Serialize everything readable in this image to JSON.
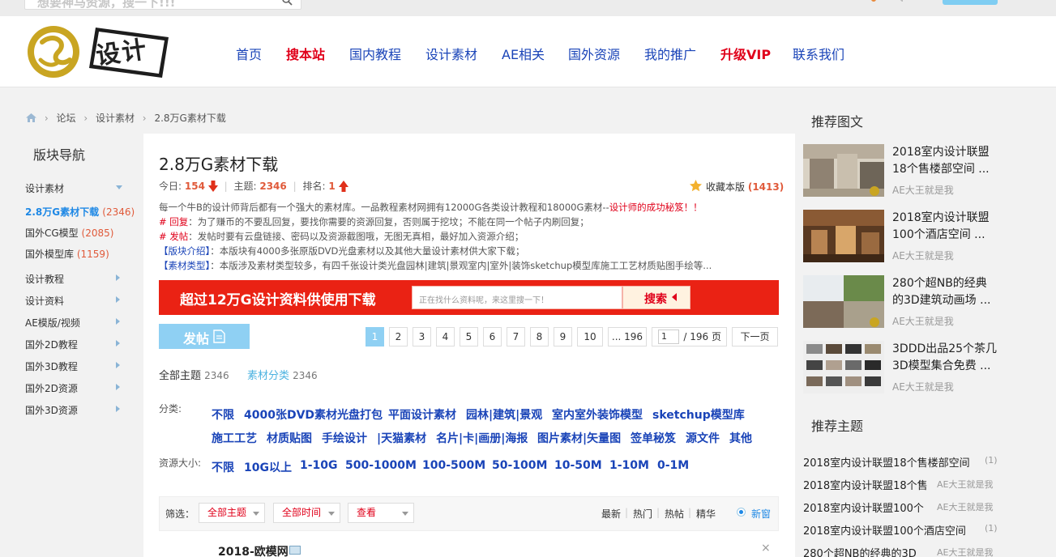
{
  "top_search": {
    "placeholder": "想要神马资源，搜一下!!!"
  },
  "logo": {
    "text": "设计"
  },
  "nav": [
    "首页",
    "搜本站",
    "国内教程",
    "设计素材",
    "AE相关",
    "国外资源",
    "我的推广",
    "升级VIP",
    "联系我们"
  ],
  "breadcrumb": [
    "论坛",
    "设计素材",
    "2.8万G素材下载"
  ],
  "sidebar": {
    "title": "版块导航",
    "items": [
      {
        "label": "设计素材",
        "count": ""
      },
      {
        "label": "2.8万G素材下载",
        "count": "(2346)"
      },
      {
        "label": "国外CG模型",
        "count": "(2085)"
      },
      {
        "label": "国外模型库",
        "count": "(1159)"
      },
      {
        "label": "设计教程",
        "count": ""
      },
      {
        "label": "设计资料",
        "count": ""
      },
      {
        "label": "AE模版/视频",
        "count": ""
      },
      {
        "label": "国外2D教程",
        "count": ""
      },
      {
        "label": "国外3D教程",
        "count": ""
      },
      {
        "label": "国外2D资源",
        "count": ""
      },
      {
        "label": "国外3D资源",
        "count": ""
      }
    ]
  },
  "forum": {
    "title": "2.8万G素材下载",
    "today_label": "今日:",
    "today": "154",
    "topics_label": "主题:",
    "topics": "2346",
    "rank_label": "排名:",
    "rank": "1",
    "favorite_label": "收藏本版",
    "favorite_count": "(1413)",
    "desc1_a": "每一个牛B的设计师背后都有一个强大的素材库。一品教程素材网拥有12000G各类设计教程和18000G素材--",
    "desc1_b": "设计师的成功秘笈！！",
    "desc2_a": "# 回复",
    "desc2_b": "：为了赚币的不要乱回复，要找你需要的资源回复，否则属于挖坟；不能在同一个帖子内刷回复；",
    "desc3_a": "# 发帖",
    "desc3_b": "：发帖时要有云盘链接、密码以及资源截图哦，无图无真相，最好加入资源介绍；",
    "desc4_a": "【版块介绍】",
    "desc4_b": "：本版块有4000多张原版DVD光盘素材以及其他大量设计素材供大家下载；",
    "desc5_a": "【素材类型】",
    "desc5_b": "：本版涉及素材类型较多，有四千张设计类光盘园林|建筑|景观室内|室外|装饰sketchup模型库施工工艺材质贴图手绘等..."
  },
  "banner": {
    "text": "超过12万G设计资料供使用下载",
    "placeholder": "正在找什么资料呢，来这里搜一下！",
    "button": "搜索"
  },
  "post_button": "发帖",
  "pagination": {
    "pages": [
      "1",
      "2",
      "3",
      "4",
      "5",
      "6",
      "7",
      "8",
      "9",
      "10",
      "... 196"
    ],
    "current": "1",
    "input_value": "1",
    "total": "/ 196 页",
    "next": "下一页"
  },
  "tabs": {
    "all_label": "全部主题",
    "all_count": "2346",
    "cat_label": "素材分类",
    "cat_count": "2346"
  },
  "filters": {
    "category_label": "分类:",
    "categories_row1": [
      "不限",
      "4000张DVD素材光盘打包",
      "平面设计素材",
      "园林|建筑|景观",
      "室内室外装饰模型",
      "sketchup模型库"
    ],
    "categories_row2": [
      "施工工艺",
      "材质贴图",
      "手绘设计",
      "|天猫素材",
      "名片|卡|画册|海报",
      "图片素材|矢量图",
      "签单秘笈",
      "源文件",
      "其他"
    ],
    "size_label": "资源大小:",
    "sizes": [
      "不限",
      "10G以上",
      "1-10G",
      "500-1000M",
      "100-500M",
      "50-100M",
      "10-50M",
      "1-10M",
      "0-1M"
    ]
  },
  "filter_bar": {
    "label": "筛选：",
    "select1": "全部主题",
    "select2": "全部时间",
    "select3": "查看",
    "sorts": [
      "最新",
      "热门",
      "热帖",
      "精华"
    ],
    "new_window": "新窗"
  },
  "first_row": {
    "title": "2018-欧模网"
  },
  "right": {
    "rec_title": "推荐图文",
    "rec_items": [
      {
        "title": "2018室内设计联盟18个售楼部空间 ...",
        "author": "AE大王就是我"
      },
      {
        "title": "2018室内设计联盟100个酒店空间 ...",
        "author": "AE大王就是我"
      },
      {
        "title": "280个超NB的经典的3D建筑动画场 ...",
        "author": "AE大王就是我"
      },
      {
        "title": "3DDD出品25个茶几3D模型集合免费 ...",
        "author": "AE大王就是我"
      }
    ],
    "topic_title": "推荐主题",
    "topics": [
      {
        "title": "2018室内设计联盟18个售楼部空间",
        "right": "(1)"
      },
      {
        "title": "2018室内设计联盟18个售",
        "right": "AE大王就是我"
      },
      {
        "title": "2018室内设计联盟100个",
        "right": "AE大王就是我"
      },
      {
        "title": "2018室内设计联盟100个酒店空间",
        "right": "(1)"
      },
      {
        "title": "280个超NB的经典的3D",
        "right": "AE大王就是我"
      }
    ]
  },
  "colors": {
    "link_blue": "#1a44b8",
    "accent_red": "#e0001a",
    "light_blue": "#8fd0f3",
    "count_orange": "#e05a3a"
  }
}
